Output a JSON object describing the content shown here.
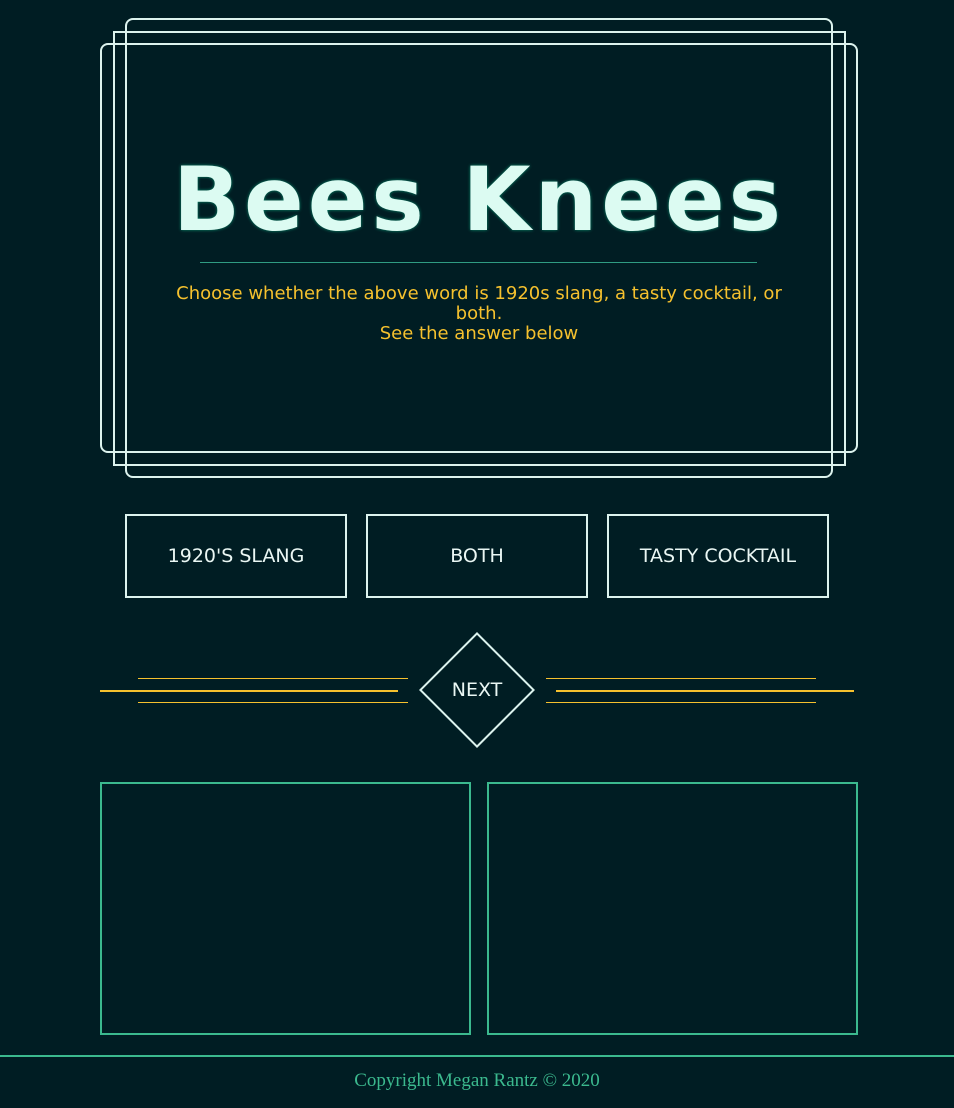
{
  "hero": {
    "title": "Bees Knees",
    "subtitle_line1": "Choose whether the above word is 1920s slang, a tasty cocktail, or both.",
    "subtitle_line2": "See the answer below"
  },
  "choices": [
    {
      "label": "1920's Slang"
    },
    {
      "label": "Both"
    },
    {
      "label": "Tasty Cocktail"
    }
  ],
  "next": {
    "label": "Next"
  },
  "footer": {
    "copyright": "Copyright Megan Rantz © 2020"
  },
  "colors": {
    "background": "#001d23",
    "frame": "#dcf3ee",
    "title": "#dcfbf2",
    "accent_gold": "#f5c12e",
    "accent_green": "#3bb98e"
  }
}
